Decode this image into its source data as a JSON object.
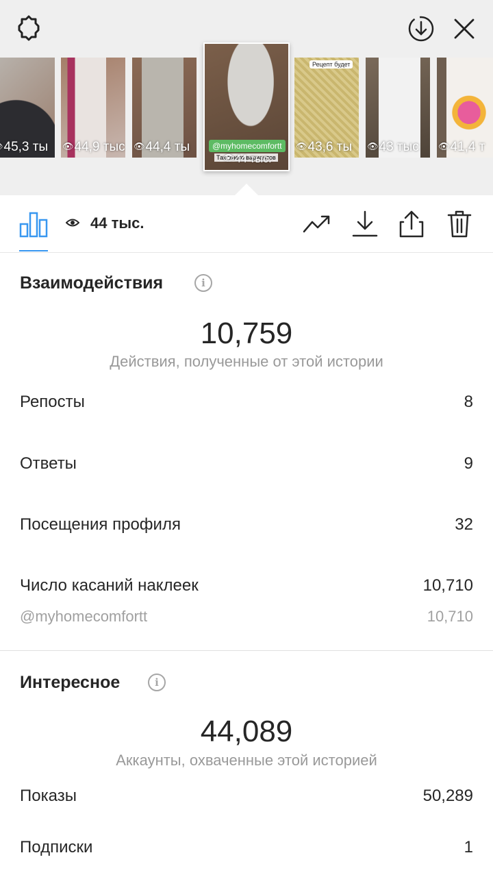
{
  "top": {
    "icons": [
      "gear-icon",
      "download-circle-icon",
      "close-icon"
    ],
    "thumbnails": [
      {
        "views": "45,3 ты",
        "colors": [
          "#9a7d6c",
          "#2c2c30"
        ]
      },
      {
        "views": "44,9 тыс",
        "colors": [
          "#c8b7b0",
          "#a8325e"
        ]
      },
      {
        "views": "44,4 ты",
        "colors": [
          "#8b6a55",
          "#b9b5ad"
        ]
      },
      {
        "views": "44 тыс.",
        "sticker": "@myhomecomfortt",
        "caption": "Так много вариантов",
        "colors": [
          "#7b5f4a",
          "#c5c3bf"
        ],
        "active": true
      },
      {
        "views": "43,6 ты",
        "overlay": "Рецепт будет",
        "colors": [
          "#d9c98a",
          "#8f9570"
        ]
      },
      {
        "views": "43 тыс",
        "colors": [
          "#7a6a5a",
          "#e24c4c"
        ]
      },
      {
        "views": "41,4 т",
        "colors": [
          "#6e5e50",
          "#e9e4de"
        ]
      }
    ]
  },
  "toolbar": {
    "view_count": "44 тыс.",
    "icons": [
      "insights-bar-icon",
      "eye-icon",
      "trending-icon",
      "save-icon",
      "share-icon",
      "trash-icon"
    ],
    "accent": "#3897f0"
  },
  "interactions": {
    "title": "Взаимодействия",
    "total": "10,759",
    "total_label": "Действия, полученные от этой истории",
    "rows": [
      {
        "label": "Репосты",
        "value": "8"
      },
      {
        "label": "Ответы",
        "value": "9"
      },
      {
        "label": "Посещения профиля",
        "value": "32"
      },
      {
        "label": "Число касаний наклеек",
        "value": "10,710"
      }
    ],
    "sticker_row": {
      "label": "@myhomecomfortt",
      "value": "10,710"
    }
  },
  "discovery": {
    "title": "Интересное",
    "total": "44,089",
    "total_label": "Аккаунты, охваченные этой историей",
    "rows": [
      {
        "label": "Показы",
        "value": "50,289"
      },
      {
        "label": "Подписки",
        "value": "1"
      }
    ]
  }
}
